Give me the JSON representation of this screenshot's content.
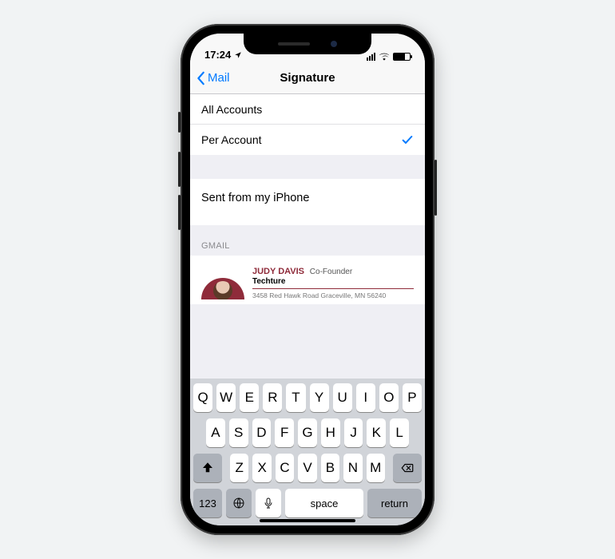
{
  "status": {
    "time": "17:24"
  },
  "nav": {
    "back_label": "Mail",
    "title": "Signature"
  },
  "options": {
    "all_accounts": "All Accounts",
    "per_account": "Per Account",
    "selected": "per_account"
  },
  "editor": {
    "default_signature": "Sent from my iPhone"
  },
  "section": {
    "gmail_label": "GMAIL"
  },
  "signature": {
    "name": "JUDY DAVIS",
    "role": "Co-Founder",
    "company": "Techture",
    "address": "3458 Red Hawk Road Graceville, MN 56240"
  },
  "keyboard": {
    "row1": [
      "Q",
      "W",
      "E",
      "R",
      "T",
      "Y",
      "U",
      "I",
      "O",
      "P"
    ],
    "row2": [
      "A",
      "S",
      "D",
      "F",
      "G",
      "H",
      "J",
      "K",
      "L"
    ],
    "row3": [
      "Z",
      "X",
      "C",
      "V",
      "B",
      "N",
      "M"
    ],
    "num_label": "123",
    "space_label": "space",
    "return_label": "return"
  }
}
